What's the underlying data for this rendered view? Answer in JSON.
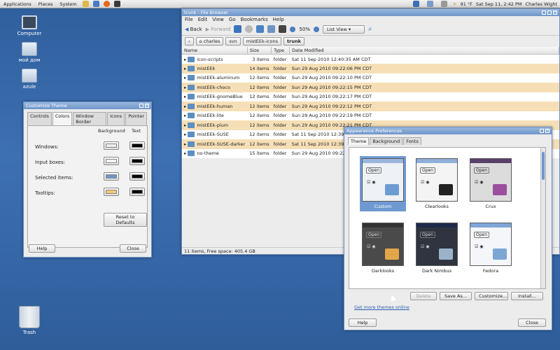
{
  "top_panel": {
    "menus": [
      "Applications",
      "Places",
      "System"
    ],
    "weather": "91 °F",
    "clock": "Sat Sep 11,  2:42 PM",
    "user": "Charles Wight"
  },
  "desktop": {
    "icons": [
      {
        "label": "Computer"
      },
      {
        "label": "мой дом"
      },
      {
        "label": "azule"
      },
      {
        "label": "Trash"
      }
    ]
  },
  "file_browser": {
    "title": "trunk - File Browser",
    "menu": [
      "File",
      "Edit",
      "View",
      "Go",
      "Bookmarks",
      "Help"
    ],
    "back_label": "Back",
    "forward_label": "Forward",
    "zoom": "50%",
    "view_mode": "List View",
    "path": [
      "charles",
      "svn",
      "mistEEk-icons",
      "trunk"
    ],
    "columns": [
      "Name",
      "Size",
      "Type",
      "Date Modified"
    ],
    "rows": [
      {
        "name": "icon-scripts",
        "size": "3 items",
        "type": "folder",
        "date": "Sat 11 Sep 2010 12:40:35 AM CDT",
        "hl": false
      },
      {
        "name": "mistEEk",
        "size": "14 items",
        "type": "folder",
        "date": "Sun 29 Aug 2010 09:22:06 PM CDT",
        "hl": true
      },
      {
        "name": "mistEEk-aluminum",
        "size": "12 items",
        "type": "folder",
        "date": "Sun 29 Aug 2010 09:22:10 PM CDT",
        "hl": false
      },
      {
        "name": "mistEEk-choco",
        "size": "12 items",
        "type": "folder",
        "date": "Sun 29 Aug 2010 09:22:15 PM CDT",
        "hl": true
      },
      {
        "name": "mistEEk-gnomeBlue",
        "size": "12 items",
        "type": "folder",
        "date": "Sun 29 Aug 2010 09:22:17 PM CDT",
        "hl": false
      },
      {
        "name": "mistEEk-human",
        "size": "12 items",
        "type": "folder",
        "date": "Sun 29 Aug 2010 09:22:12 PM CDT",
        "hl": true
      },
      {
        "name": "mistEEk-lite",
        "size": "12 items",
        "type": "folder",
        "date": "Sun 29 Aug 2010 09:22:19 PM CDT",
        "hl": false
      },
      {
        "name": "mistEEk-plum",
        "size": "12 items",
        "type": "folder",
        "date": "Sun 29 Aug 2010 09:22:21 PM CDT",
        "hl": true
      },
      {
        "name": "mistEEk-SUSE",
        "size": "12 items",
        "type": "folder",
        "date": "Sat 11 Sep 2010 12:39:35 AM CDT",
        "hl": false
      },
      {
        "name": "mistEEk-SUSE-darker",
        "size": "12 items",
        "type": "folder",
        "date": "Sat 11 Sep 2010 12:39:40 AM CDT",
        "hl": true
      },
      {
        "name": "no-theme",
        "size": "15 items",
        "type": "folder",
        "date": "Sun 29 Aug 2010 09:22:21 PM CDT",
        "hl": false
      }
    ],
    "status": "11 items, Free space: 405.4 GB"
  },
  "customize_theme": {
    "title": "Customize Theme",
    "tabs": [
      "Controls",
      "Colors",
      "Window Border",
      "Icons",
      "Pointer"
    ],
    "active_tab": 1,
    "col_background": "Background",
    "col_text": "Text",
    "rows": [
      {
        "label": "Windows:",
        "bg": "#ececec",
        "fg": "#000000"
      },
      {
        "label": "Input boxes:",
        "bg": "#f2f2f2",
        "fg": "#000000"
      },
      {
        "label": "Selected items:",
        "bg": "#7196cf",
        "fg": "#000000"
      },
      {
        "label": "Tooltips:",
        "bg": "#f6c777",
        "fg": "#000000"
      }
    ],
    "reset_label": "Reset to Defaults",
    "help_label": "Help",
    "close_label": "Close"
  },
  "appearance": {
    "title": "Appearance Preferences",
    "tabs": [
      "Theme",
      "Background",
      "Fonts"
    ],
    "open_label": "Open",
    "themes": [
      {
        "name": "Custom",
        "selected": true,
        "bg": "#eef1f5",
        "bar": "#9ab6dc",
        "folder": "#6e9cd2"
      },
      {
        "name": "Clearlooks",
        "selected": false,
        "bg": "#f4f4f4",
        "bar": "#8fb0da",
        "folder": "#222222"
      },
      {
        "name": "Crux",
        "selected": false,
        "bg": "#dcdcdc",
        "bar": "#5a3f6a",
        "folder": "#9b4f9d"
      },
      {
        "name": "Darklooks",
        "selected": false,
        "bg": "#4a4a4a",
        "bar": "#333333",
        "folder": "#e2a64a"
      },
      {
        "name": "Dark Nimbus",
        "selected": false,
        "bg": "#2f3440",
        "bar": "#1d2a48",
        "folder": "#9bb3c8"
      },
      {
        "name": "Fedora",
        "selected": false,
        "bg": "#f4f6f9",
        "bar": "#7fa6d8",
        "folder": "#7ea6d4"
      }
    ],
    "delete_label": "Delete",
    "save_as_label": "Save As...",
    "customize_label": "Customize...",
    "install_label": "Install...",
    "more_themes_link": "Get more themes online",
    "help_label": "Help",
    "close_label": "Close"
  }
}
